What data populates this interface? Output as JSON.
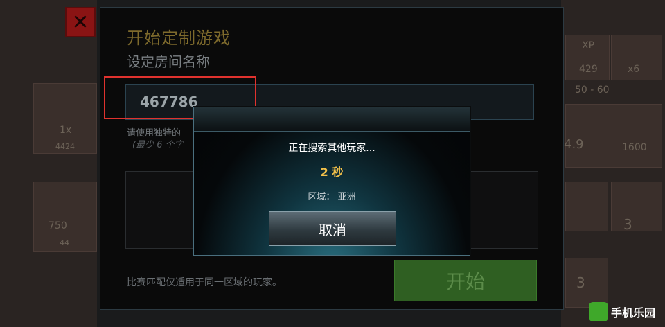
{
  "background": {
    "close_glyph": "✕",
    "left_texts": [
      "1x",
      "4424",
      "750",
      "44"
    ],
    "right_texts": [
      "XP",
      "429",
      "x6",
      "50 - 60",
      "1600",
      "4.9",
      "3",
      "3"
    ]
  },
  "dialog": {
    "title": "开始定制游戏",
    "subtitle": "设定房间名称",
    "room_name_value": "467786",
    "hint_line1": "请使用独特的",
    "hint_line2": "(最少 6 个字",
    "footer_note": "比赛匹配仅适用于同一区域的玩家。",
    "start_label": "开始"
  },
  "modal": {
    "message": "正在搜索其他玩家...",
    "timer": "2 秒",
    "region": "区域： 亚洲",
    "cancel_label": "取消"
  },
  "watermark": {
    "text": "手机乐园"
  },
  "colors": {
    "highlight": "#e0322e",
    "timer": "#f2c04a",
    "start_button": "#2f5f22"
  }
}
